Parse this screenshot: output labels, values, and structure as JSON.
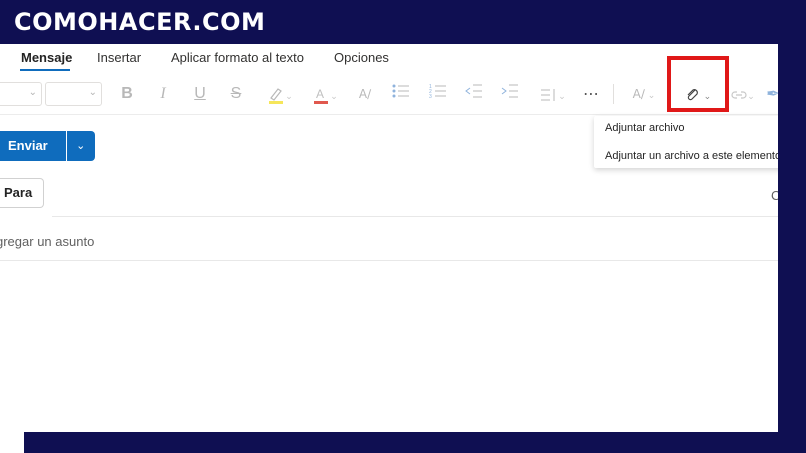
{
  "brand": {
    "logo_text": "COMOHACER.COM"
  },
  "tabs": [
    {
      "label": "Mensaje",
      "active": true
    },
    {
      "label": "Insertar"
    },
    {
      "label": "Aplicar formato al texto"
    },
    {
      "label": "Opciones"
    }
  ],
  "ribbon": {
    "icons": [
      "bold-icon",
      "italic-icon",
      "underline-icon",
      "strikethrough-icon",
      "highlight-icon",
      "font-color-icon",
      "styles-icon",
      "bullet-list-icon",
      "numbered-list-icon",
      "decrease-indent-icon",
      "increase-indent-icon",
      "line-spacing-icon",
      "more-icon",
      "editor-icon",
      "attach-icon",
      "link-icon"
    ],
    "highlight_color": "#e01818"
  },
  "attach_menu": {
    "items": [
      "Adjuntar archivo",
      "Adjuntar un archivo a este elemento"
    ]
  },
  "compose": {
    "send_label": "Enviar",
    "to_label": "Para",
    "subject_placeholder": "gregar un asunto",
    "right_fragment": "C"
  },
  "colors": {
    "accent": "#0f6cbd",
    "frame": "#0f0f52"
  }
}
